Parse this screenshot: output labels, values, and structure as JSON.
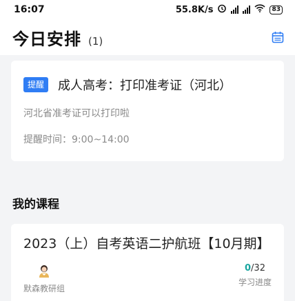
{
  "status": {
    "time": "16:07",
    "speed": "55.8K/s",
    "battery": "83"
  },
  "header": {
    "title": "今日安排",
    "count": "(1)"
  },
  "reminder": {
    "tag": "提醒",
    "title": "成人高考：打印准考证（河北）",
    "description": "河北省准考证可以打印啦",
    "time": "提醒时间：9:00~14:00"
  },
  "courses": {
    "section_title": "我的课程",
    "items": [
      {
        "title": "2023（上）自考英语二护航班【10月期】",
        "teacher": "默森教研组",
        "progress_done": "0",
        "progress_total": "/32",
        "progress_label": "学习进度"
      }
    ]
  },
  "colors": {
    "accent": "#2f7df4",
    "progress": "#1aa6a0"
  }
}
